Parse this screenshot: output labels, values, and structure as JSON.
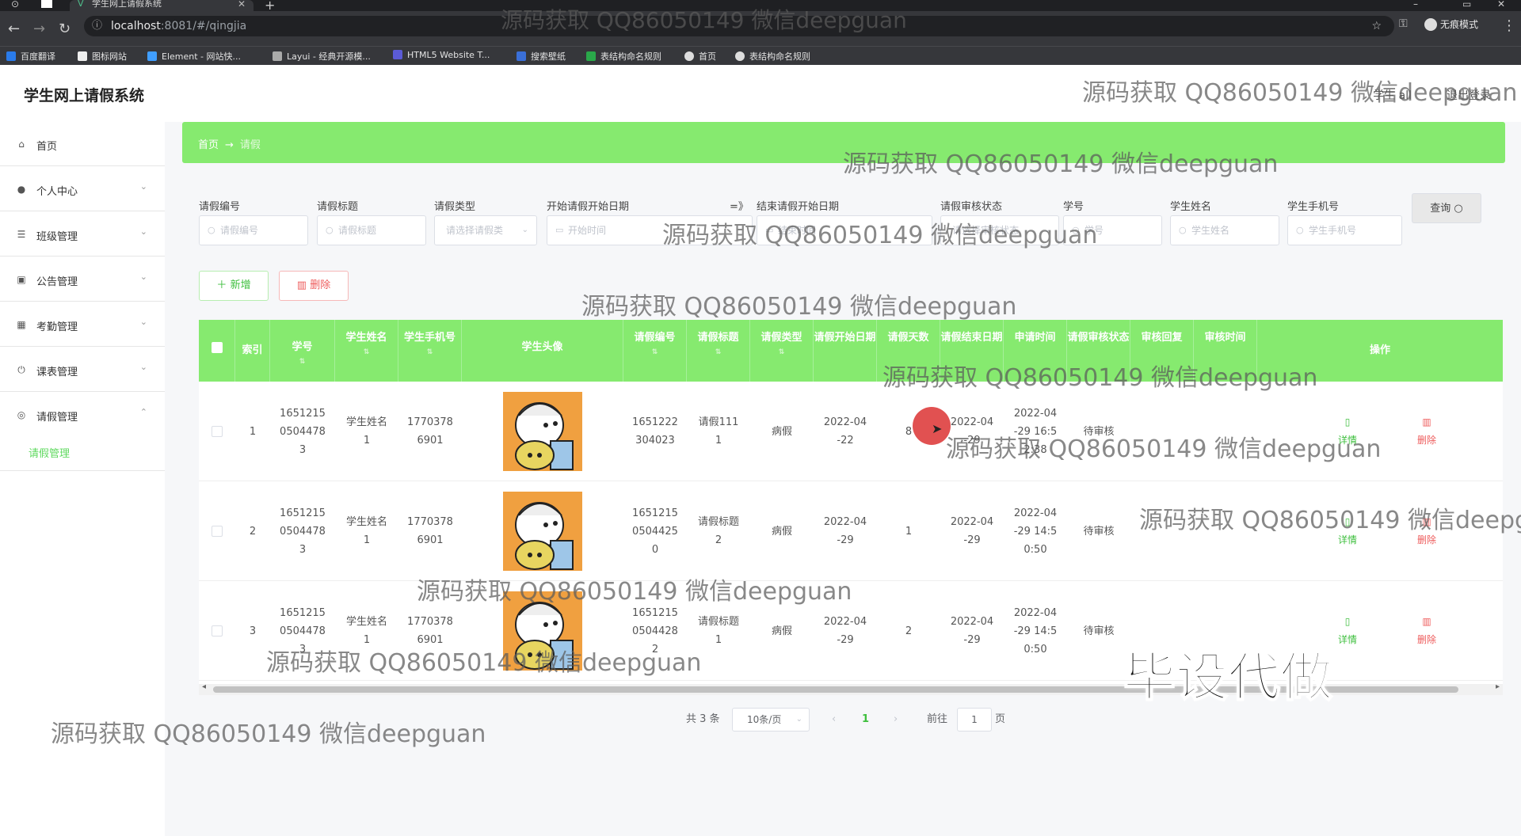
{
  "browser": {
    "tab_title": "学生网上请假系统",
    "url_host": "localhost",
    "url_path": ":8081/#/qingjia",
    "incognito_label": "无痕模式",
    "bookmarks": [
      "百度翻译",
      "图标网站",
      "Element - 网站快...",
      "Layui - 经典开源模...",
      "HTML5 Website T...",
      "搜索壁纸",
      "表结构命名规则",
      "首页",
      "表结构命名规则"
    ]
  },
  "header": {
    "title": "学生网上请假系统",
    "user": "学生 all",
    "logout": "退出登录"
  },
  "sidebar": {
    "items": [
      {
        "label": "首页"
      },
      {
        "label": "个人中心"
      },
      {
        "label": "班级管理"
      },
      {
        "label": "公告管理"
      },
      {
        "label": "考勤管理"
      },
      {
        "label": "课表管理"
      },
      {
        "label": "请假管理"
      }
    ],
    "sub_item": "请假管理"
  },
  "breadcrumb": {
    "home": "首页",
    "sep": "→",
    "current": "请假"
  },
  "filters": {
    "labels": [
      "请假编号",
      "请假标题",
      "请假类型",
      "开始请假开始日期",
      "=》",
      "结束请假开始日期",
      "请假审核状态",
      "学号",
      "学生姓名",
      "学生手机号"
    ],
    "placeholders": {
      "qingjia_no": "请假编号",
      "qingjia_title": "请假标题",
      "qingjia_type": "请选择请假类",
      "start_date": "开始时间",
      "end_date": "结束时间",
      "status": "请选择审核状态",
      "student_no": "学号",
      "student_name": "学生姓名",
      "student_phone": "学生手机号"
    },
    "query_button": "查询"
  },
  "actions": {
    "add": "新增",
    "delete": "删除"
  },
  "table": {
    "headers": [
      "索引",
      "学号",
      "学生姓名",
      "学生手机号",
      "学生头像",
      "请假编号",
      "请假标题",
      "请假类型",
      "请假开始日期",
      "请假天数",
      "请假结束日期",
      "申请时间",
      "请假审核状态",
      "审核回复",
      "审核时间",
      "操作"
    ],
    "rows": [
      {
        "index": "1",
        "student_no": [
          "1651215",
          "0504478",
          "3"
        ],
        "name": [
          "学生姓名",
          "1"
        ],
        "phone": [
          "1770378",
          "6901"
        ],
        "qingjia_no": [
          "1651222",
          "304023"
        ],
        "title": [
          "请假111",
          "1"
        ],
        "type": "病假",
        "start": [
          "2022-04",
          "-22"
        ],
        "days": "8",
        "end": [
          "2022-04",
          "-29"
        ],
        "apply_time": [
          "2022-04",
          "-29 16:5",
          "2:38"
        ],
        "status": "待审核",
        "detail": "详情",
        "delete": "删除"
      },
      {
        "index": "2",
        "student_no": [
          "1651215",
          "0504478",
          "3"
        ],
        "name": [
          "学生姓名",
          "1"
        ],
        "phone": [
          "1770378",
          "6901"
        ],
        "qingjia_no": [
          "1651215",
          "0504425",
          "0"
        ],
        "title": [
          "请假标题",
          "2"
        ],
        "type": "病假",
        "start": [
          "2022-04",
          "-29"
        ],
        "days": "1",
        "end": [
          "2022-04",
          "-29"
        ],
        "apply_time": [
          "2022-04",
          "-29 14:5",
          "0:50"
        ],
        "status": "待审核",
        "detail": "详情",
        "delete": "删除"
      },
      {
        "index": "3",
        "student_no": [
          "1651215",
          "0504478",
          "3"
        ],
        "name": [
          "学生姓名",
          "1"
        ],
        "phone": [
          "1770378",
          "6901"
        ],
        "qingjia_no": [
          "1651215",
          "0504428",
          "2"
        ],
        "title": [
          "请假标题",
          "1"
        ],
        "type": "病假",
        "start": [
          "2022-04",
          "-29"
        ],
        "days": "2",
        "end": [
          "2022-04",
          "-29"
        ],
        "apply_time": [
          "2022-04",
          "-29 14:5",
          "0:50"
        ],
        "status": "待审核",
        "detail": "详情",
        "delete": "删除"
      }
    ]
  },
  "pagination": {
    "total": "共 3 条",
    "page_size": "10条/页",
    "current_page": "1",
    "goto_label": "前往",
    "goto_value": "1",
    "page_suffix": "页"
  },
  "overlay": {
    "watermark": "源码获取 QQ86050149 微信deepguan",
    "big_mark": "毕设代做"
  },
  "colors": {
    "accent": "#86ea6f",
    "link": "#3ebf3e",
    "danger": "#ee5b5b"
  }
}
